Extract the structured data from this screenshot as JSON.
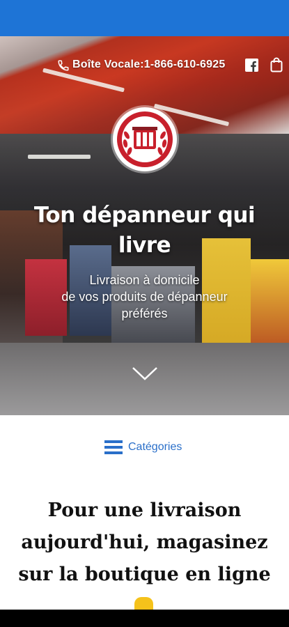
{
  "header": {
    "phone_text": "Boîte Vocale:1-866-610-6925",
    "icons": [
      "phone-icon",
      "facebook-icon",
      "shopping-bag-icon"
    ]
  },
  "hero": {
    "title": "Ton dépanneur qui livre",
    "subtitle_lines": [
      "Livraison à domicile",
      "de vos produits de dépanneur",
      "préférés"
    ],
    "scroll_icon": "chevron-down-icon"
  },
  "categories": {
    "label": "Catégories",
    "icon": "menu-icon"
  },
  "main": {
    "heading": "Pour une livraison aujourd'hui, magasinez sur la boutique en ligne"
  },
  "colors": {
    "status_bar": "#1e74d6",
    "accent_blue": "#2a6fc9",
    "logo_red": "#c8202c",
    "text_dark": "#111111"
  }
}
